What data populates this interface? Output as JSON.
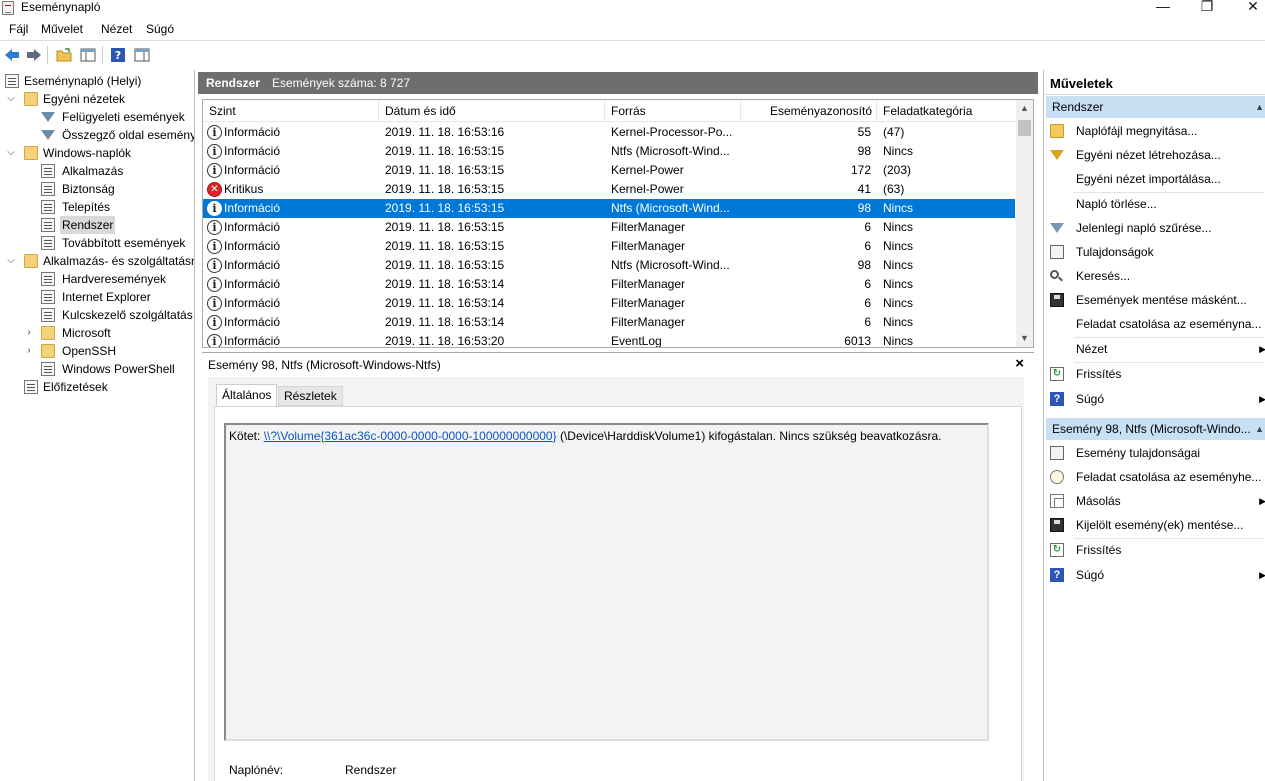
{
  "window": {
    "title": "Eseménynapló",
    "minimize": "—",
    "maximize": "❐",
    "close": "✕"
  },
  "menu": [
    "Fájl",
    "Művelet",
    "Nézet",
    "Súgó"
  ],
  "tree": {
    "root": "Eseménynapló (Helyi)",
    "custom_views": "Egyéni nézetek",
    "admin_events": "Felügyeleti események",
    "summary": "Összegző oldal eseménye",
    "windows_logs": "Windows-naplók",
    "application": "Alkalmazás",
    "security": "Biztonság",
    "setup": "Telepítés",
    "system": "Rendszer",
    "forwarded": "Továbbított események",
    "app_services": "Alkalmazás- és szolgáltatásn",
    "hardware": "Hardveresemények",
    "ie": "Internet Explorer",
    "kms": "Kulcskezelő szolgáltatás",
    "microsoft": "Microsoft",
    "openssh": "OpenSSH",
    "powershell": "Windows PowerShell",
    "subscriptions": "Előfizetések"
  },
  "center": {
    "log_name": "Rendszer",
    "count_label": "Események száma: 8 727"
  },
  "grid": {
    "columns": [
      "Szint",
      "Dátum és idő",
      "Forrás",
      "Eseményazonosító",
      "Feladatkategória"
    ],
    "rows": [
      {
        "level": "Információ",
        "level_type": "info",
        "date": "2019. 11. 18. 16:53:16",
        "source": "Kernel-Processor-Po...",
        "id": "55",
        "task": "(47)"
      },
      {
        "level": "Információ",
        "level_type": "info",
        "date": "2019. 11. 18. 16:53:15",
        "source": "Ntfs (Microsoft-Wind...",
        "id": "98",
        "task": "Nincs"
      },
      {
        "level": "Információ",
        "level_type": "info",
        "date": "2019. 11. 18. 16:53:15",
        "source": "Kernel-Power",
        "id": "172",
        "task": "(203)"
      },
      {
        "level": "Kritikus",
        "level_type": "critical",
        "date": "2019. 11. 18. 16:53:15",
        "source": "Kernel-Power",
        "id": "41",
        "task": "(63)"
      },
      {
        "level": "Információ",
        "level_type": "info",
        "date": "2019. 11. 18. 16:53:15",
        "source": "Ntfs (Microsoft-Wind...",
        "id": "98",
        "task": "Nincs"
      },
      {
        "level": "Információ",
        "level_type": "info",
        "date": "2019. 11. 18. 16:53:15",
        "source": "FilterManager",
        "id": "6",
        "task": "Nincs"
      },
      {
        "level": "Információ",
        "level_type": "info",
        "date": "2019. 11. 18. 16:53:15",
        "source": "FilterManager",
        "id": "6",
        "task": "Nincs"
      },
      {
        "level": "Információ",
        "level_type": "info",
        "date": "2019. 11. 18. 16:53:15",
        "source": "Ntfs (Microsoft-Wind...",
        "id": "98",
        "task": "Nincs"
      },
      {
        "level": "Információ",
        "level_type": "info",
        "date": "2019. 11. 18. 16:53:14",
        "source": "FilterManager",
        "id": "6",
        "task": "Nincs"
      },
      {
        "level": "Információ",
        "level_type": "info",
        "date": "2019. 11. 18. 16:53:14",
        "source": "FilterManager",
        "id": "6",
        "task": "Nincs"
      },
      {
        "level": "Információ",
        "level_type": "info",
        "date": "2019. 11. 18. 16:53:14",
        "source": "FilterManager",
        "id": "6",
        "task": "Nincs"
      },
      {
        "level": "Információ",
        "level_type": "info",
        "date": "2019. 11. 18. 16:53:20",
        "source": "EventLog",
        "id": "6013",
        "task": "Nincs"
      }
    ]
  },
  "details": {
    "title": "Esemény 98, Ntfs (Microsoft-Windows-Ntfs)",
    "close": "×",
    "tab_general": "Általános",
    "tab_details": "Részletek",
    "desc_prefix": "Kötet: ",
    "desc_link": "\\\\?\\Volume{361ac36c-0000-0000-0000-100000000000}",
    "desc_rest": " (\\Device\\HarddiskVolume1) kifogástalan. Nincs szükség beavatkozásra.",
    "log_name_label": "Naplónév:",
    "log_name_value": "Rendszer"
  },
  "actions": {
    "title": "Műveletek",
    "section1": "Rendszer",
    "open_log": "Naplófájl megnyitása...",
    "create_view": "Egyéni nézet létrehozása...",
    "import_view": "Egyéni nézet importálása...",
    "clear_log": "Napló törlése...",
    "filter_log": "Jelenlegi napló szűrése...",
    "properties": "Tulajdonságok",
    "find": "Keresés...",
    "save_all": "Események mentése másként...",
    "attach_task_log": "Feladat csatolása az eseménynа...",
    "view": "Nézet",
    "refresh": "Frissítés",
    "help": "Súgó",
    "section2": "Esemény 98, Ntfs (Microsoft-Windo...",
    "event_props": "Esemény tulajdonságai",
    "attach_task_event": "Feladat csatolása az eseményhe...",
    "copy": "Másolás",
    "save_selected": "Kijelölt esemény(ek) mentése...",
    "refresh2": "Frissítés",
    "help2": "Súgó"
  }
}
